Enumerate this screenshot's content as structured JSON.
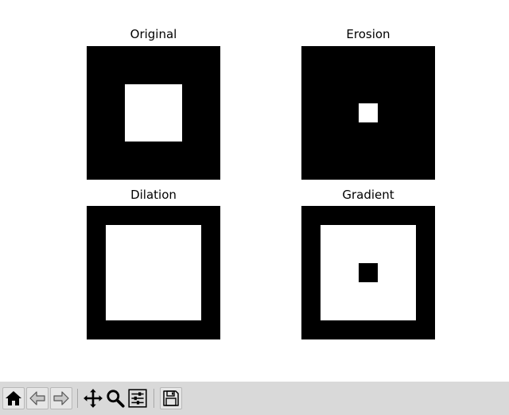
{
  "panels": [
    {
      "title": "Original"
    },
    {
      "title": "Erosion"
    },
    {
      "title": "Dilation"
    },
    {
      "title": "Gradient"
    }
  ],
  "image_colors": {
    "on": "#ffffff",
    "off": "#000000"
  },
  "toolbar": {
    "background": "#d9d9d9",
    "buttons": [
      {
        "name": "home",
        "icon": "home-icon"
      },
      {
        "name": "back",
        "icon": "arrow-left-icon"
      },
      {
        "name": "forward",
        "icon": "arrow-right-icon"
      },
      {
        "name": "pan",
        "icon": "move-icon"
      },
      {
        "name": "zoom",
        "icon": "magnifier-icon"
      },
      {
        "name": "configure-subplots",
        "icon": "sliders-icon"
      },
      {
        "name": "save",
        "icon": "floppy-disk-icon"
      }
    ]
  }
}
